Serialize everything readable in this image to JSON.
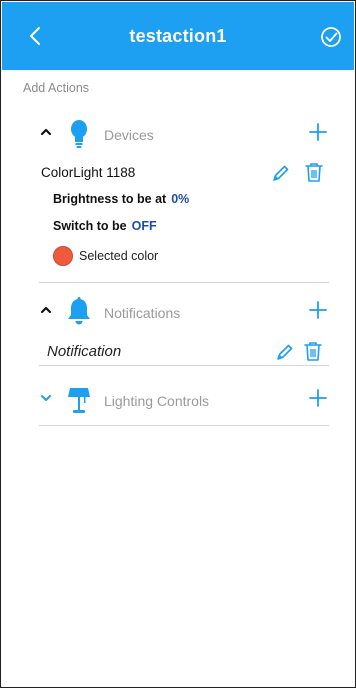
{
  "header": {
    "title": "testaction1",
    "back_icon": "chevron-left-icon",
    "confirm_icon": "check-circle-icon",
    "color": "#1d9ff2"
  },
  "add_actions_label": "Add Actions",
  "sections": [
    {
      "label": "Devices",
      "icon": "lightbulb-icon",
      "expanded": true,
      "items": [
        {
          "name": "ColorLight 1188",
          "brightness_label": "Brightness  to be at",
          "brightness_value": "0%",
          "switch_label": "Switch to be",
          "switch_value": "OFF",
          "color_label": "Selected color",
          "color_hex": "#ee5a3c"
        }
      ]
    },
    {
      "label": "Notifications",
      "icon": "bell-icon",
      "expanded": true,
      "items": [
        {
          "name": "Notification"
        }
      ]
    },
    {
      "label": "Lighting Controls",
      "icon": "lamp-icon",
      "expanded": false,
      "items": []
    }
  ],
  "accent": "#1d9ff2"
}
